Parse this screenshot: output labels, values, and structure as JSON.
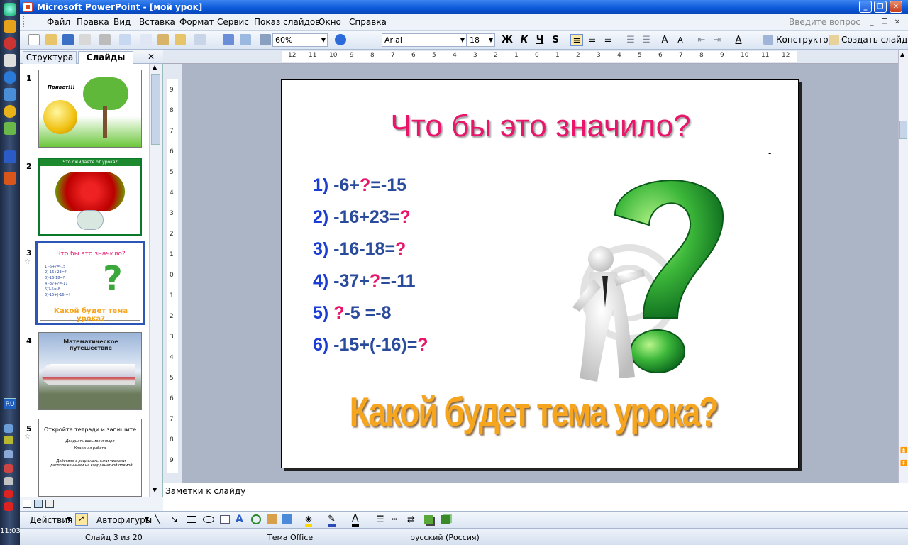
{
  "window": {
    "title": "Microsoft PowerPoint - [мой урок]"
  },
  "menu": {
    "items": [
      "Файл",
      "Правка",
      "Вид",
      "Вставка",
      "Формат",
      "Сервис",
      "Показ слайдов",
      "Окно",
      "Справка"
    ],
    "ask_placeholder": "Введите вопрос"
  },
  "toolbar": {
    "zoom": "60%",
    "font": "Arial",
    "size": "18",
    "bold": "Ж",
    "italic": "К",
    "underline": "Ч",
    "shadow": "S",
    "designer_label": "Конструктор",
    "new_slide_label": "Создать слайд"
  },
  "leftpane": {
    "tab_outline": "Структура",
    "tab_slides": "Слайды",
    "close": "✕",
    "thumbs": [
      {
        "num": "1",
        "caption": "Привет!!!"
      },
      {
        "num": "2",
        "caption": "Что ожидаете от урока?"
      },
      {
        "num": "3",
        "caption": "Что бы это значило?",
        "subtitle": "Какой будет тема урока?",
        "lines": [
          "1)-6+?=-15",
          "2)-16+23=?",
          "3)-16-18=?",
          "4)-37+?=-11",
          "5)?-5=-8",
          "6)-15+(-16)=?"
        ]
      },
      {
        "num": "4",
        "caption": "Математическое путешествие"
      },
      {
        "num": "5",
        "caption": "Откройте тетради и запишите",
        "lines": [
          "Двадцать восьмое января",
          "Классная работа",
          "Действия с рациональными числами, расположенными на координатной прямой"
        ]
      }
    ]
  },
  "ruler": {
    "h_ticks": [
      "12",
      "11",
      "10",
      "9",
      "8",
      "7",
      "6",
      "5",
      "4",
      "3",
      "2",
      "1",
      "0",
      "1",
      "2",
      "3",
      "4",
      "5",
      "6",
      "7",
      "8",
      "9",
      "10",
      "11",
      "12"
    ],
    "v_ticks": [
      "9",
      "8",
      "7",
      "6",
      "5",
      "4",
      "3",
      "2",
      "1",
      "0",
      "1",
      "2",
      "3",
      "4",
      "5",
      "6",
      "7",
      "8",
      "9"
    ]
  },
  "slide": {
    "title": "Что бы это значило?",
    "equations": [
      {
        "n": "1)",
        "parts": [
          {
            "t": " -6+",
            "q": false
          },
          {
            "t": "?",
            "q": true
          },
          {
            "t": "=-15",
            "q": false
          }
        ]
      },
      {
        "n": "2)",
        "parts": [
          {
            "t": " -16+23=",
            "q": false
          },
          {
            "t": "?",
            "q": true
          }
        ]
      },
      {
        "n": "3)",
        "parts": [
          {
            "t": " -16-18=",
            "q": false
          },
          {
            "t": "?",
            "q": true
          }
        ]
      },
      {
        "n": "4)",
        "parts": [
          {
            "t": " -37+",
            "q": false
          },
          {
            "t": "?",
            "q": true
          },
          {
            "t": "=-11",
            "q": false
          }
        ]
      },
      {
        "n": "5)",
        "parts": [
          {
            "t": " ",
            "q": false
          },
          {
            "t": "?",
            "q": true
          },
          {
            "t": "-5 =-8",
            "q": false
          }
        ]
      },
      {
        "n": "6)",
        "parts": [
          {
            "t": " -15+(-16)=",
            "q": false
          },
          {
            "t": "?",
            "q": true
          }
        ]
      }
    ],
    "subtitle": "Какой будет тема урока?",
    "marker": "-"
  },
  "notes": {
    "label": "Заметки к слайду"
  },
  "drawbar": {
    "actions": "Действия",
    "autoshapes": "Автофигуры"
  },
  "status": {
    "slide": "Слайд 3 из 20",
    "theme": "Тема Office",
    "language": "русский (Россия)"
  },
  "system": {
    "clock": "11:03",
    "lang": "RU"
  },
  "colors": {
    "title_pink": "#e8156b",
    "eq_blue": "#2a4a9c",
    "subtitle_orange": "#f6a51e",
    "selection_blue": "#2c56b6"
  }
}
